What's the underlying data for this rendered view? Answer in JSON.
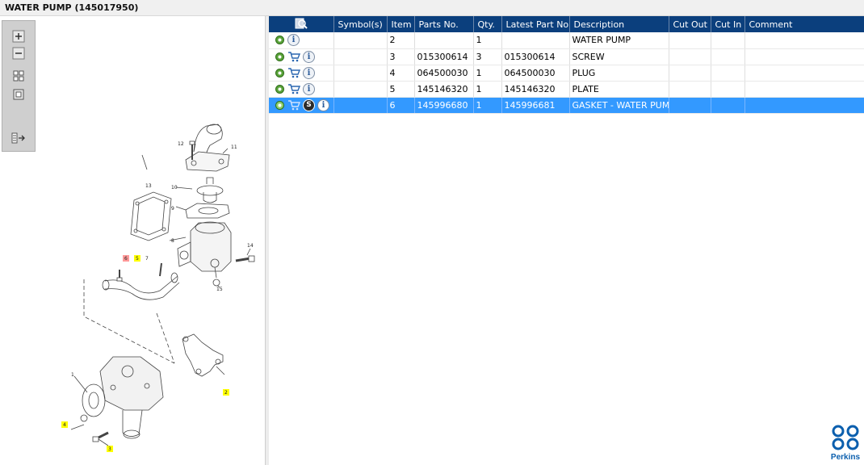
{
  "window": {
    "title": "WATER PUMP (145017950)"
  },
  "toolbar": {
    "buttons": [
      {
        "name": "zoom-in",
        "icon": "plus-icon"
      },
      {
        "name": "zoom-out",
        "icon": "minus-icon"
      },
      {
        "name": "fit-all",
        "icon": "grid-icon"
      },
      {
        "name": "actual-size",
        "icon": "square-icon"
      },
      {
        "name": "export",
        "icon": "list-arrow-icon"
      }
    ]
  },
  "diagram": {
    "callouts": {
      "c1": "1",
      "c2": "2",
      "c3": "3",
      "c4": "4",
      "c5": "5",
      "c6": "6",
      "c7": "7",
      "c8": "8",
      "c9": "9",
      "c10": "10",
      "c11": "11",
      "c12": "12",
      "c13": "13",
      "c14": "14",
      "c15": "15"
    },
    "highlight_color": "#ffff00",
    "selected_color": "#ff9999"
  },
  "grid": {
    "columns": {
      "icons": "",
      "symbols": "Symbol(s)",
      "item": "Item",
      "parts_no": "Parts No.",
      "qty": "Qty.",
      "latest": "Latest Part No.",
      "description": "Description",
      "cut_out": "Cut Out",
      "cut_in": "Cut In",
      "comment": "Comment"
    },
    "rows": [
      {
        "item": "2",
        "parts_no": "",
        "qty": "1",
        "latest": "",
        "description": "WATER PUMP",
        "cut_out": "",
        "cut_in": "",
        "comment": ""
      },
      {
        "item": "3",
        "parts_no": "015300614",
        "qty": "3",
        "latest": "015300614",
        "description": "SCREW",
        "cut_out": "",
        "cut_in": "",
        "comment": ""
      },
      {
        "item": "4",
        "parts_no": "064500030",
        "qty": "1",
        "latest": "064500030",
        "description": "PLUG",
        "cut_out": "",
        "cut_in": "",
        "comment": ""
      },
      {
        "item": "5",
        "parts_no": "145146320",
        "qty": "1",
        "latest": "145146320",
        "description": "PLATE",
        "cut_out": "",
        "cut_in": "",
        "comment": ""
      },
      {
        "item": "6",
        "parts_no": "145996680",
        "qty": "1",
        "latest": "145996681",
        "description": "GASKET - WATER PUMP",
        "cut_out": "",
        "cut_in": "",
        "comment": ""
      }
    ],
    "selected_row": 5,
    "header_color": "#0b3f7d",
    "selection_color": "#3399ff"
  },
  "brand": {
    "logo_text": "Perkins"
  }
}
